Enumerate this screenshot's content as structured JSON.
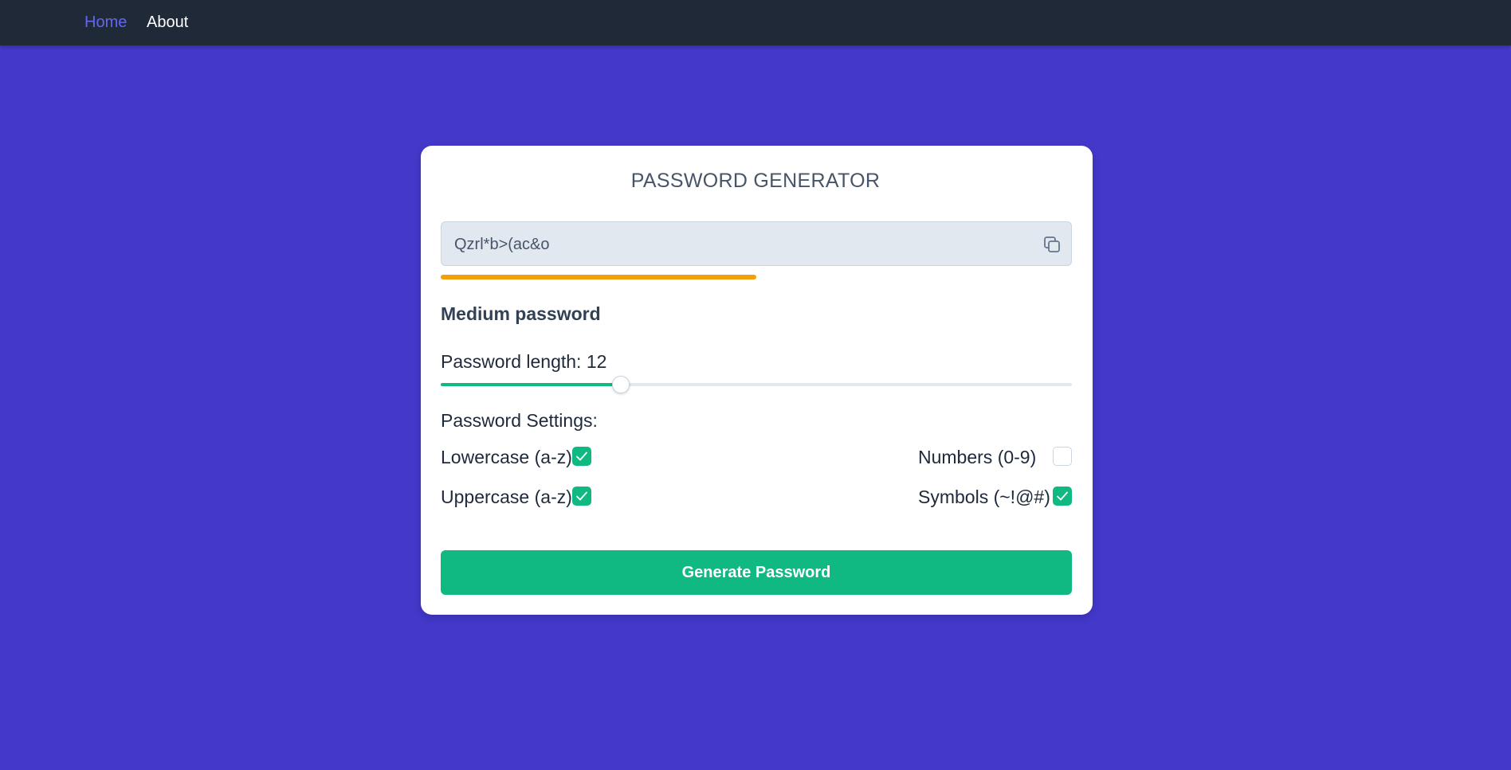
{
  "nav": {
    "items": [
      {
        "label": "Home",
        "active": true
      },
      {
        "label": "About",
        "active": false
      }
    ]
  },
  "card": {
    "title": "PASSWORD GENERATOR",
    "password": "Qzrl*b>(ac&o",
    "strength": {
      "label": "Medium password",
      "fraction": 0.5,
      "color": "#f59e0b"
    },
    "length": {
      "label": "Password length: 12",
      "value": 12,
      "min": 4,
      "max": 32
    },
    "settings_label": "Password Settings:",
    "options": {
      "lowercase": {
        "label": "Lowercase (a-z)",
        "checked": true
      },
      "uppercase": {
        "label": "Uppercase (a-z)",
        "checked": true
      },
      "numbers": {
        "label": "Numbers (0-9)",
        "checked": false
      },
      "symbols": {
        "label": "Symbols (~!@#)",
        "checked": true
      }
    },
    "generate_label": "Generate Password"
  },
  "colors": {
    "background": "#4338ca",
    "navbar": "#1f2937",
    "accent": "#10b981",
    "active_link": "#6366f1"
  },
  "icons": {
    "copy": "copy-icon",
    "check": "check-icon"
  }
}
